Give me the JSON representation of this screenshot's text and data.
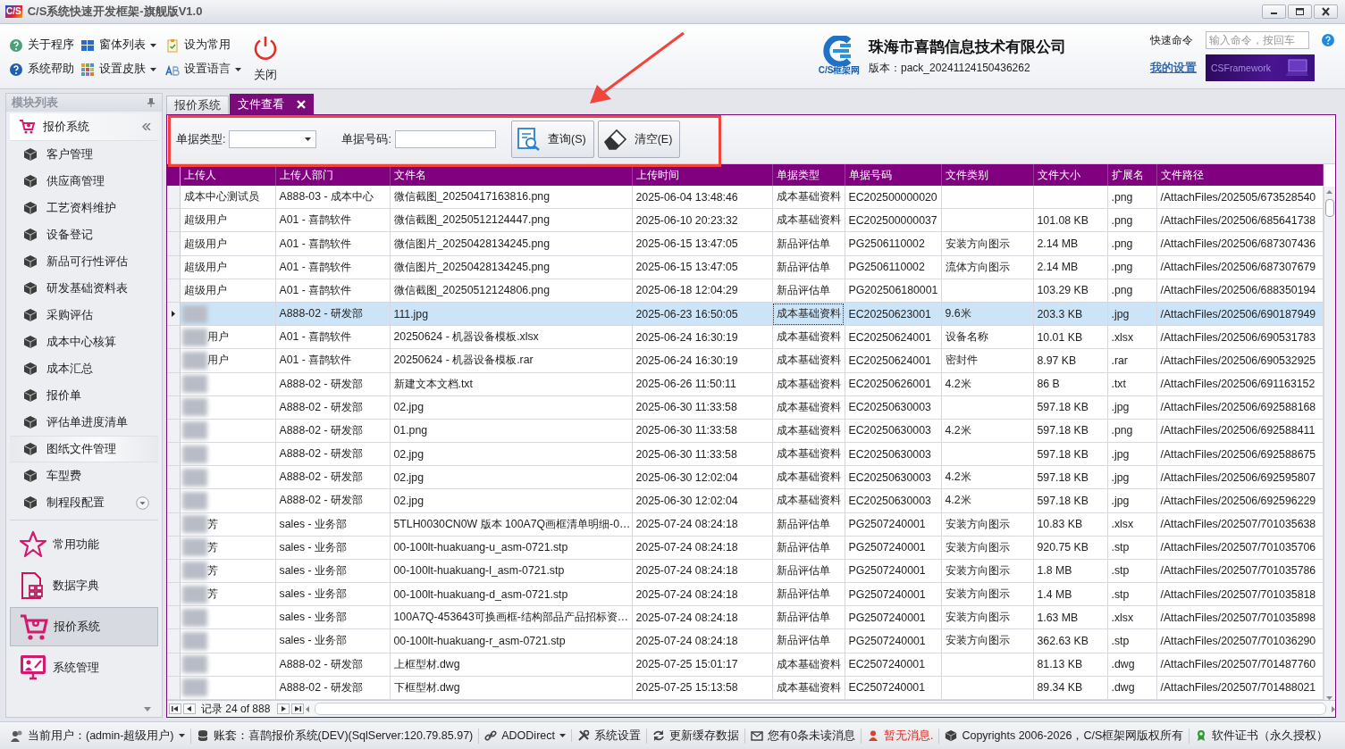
{
  "window": {
    "app_icon_text": "C/S",
    "title": "C/S系统快速开发框架-旗舰版V1.0"
  },
  "ribbon": {
    "buttons": [
      {
        "label": "关于程序",
        "has_menu": false
      },
      {
        "label": "窗体列表",
        "has_menu": true
      },
      {
        "label": "设为常用",
        "has_menu": false
      },
      {
        "label": "系统帮助",
        "has_menu": false
      },
      {
        "label": "设置皮肤",
        "has_menu": true
      },
      {
        "label": "设置语言",
        "has_menu": true
      }
    ],
    "close_button": {
      "label": "关闭"
    }
  },
  "company": {
    "logo_text": "C/S框架网",
    "name": "珠海市喜鹊信息技术有限公司",
    "version": "版本：pack_20241124150436262"
  },
  "quick_command": {
    "label": "快速命令",
    "placeholder": "输入命令，按回车"
  },
  "my_settings_link": "我的设置",
  "banner": {
    "text": "CSFramework"
  },
  "sidebar": {
    "title": "模块列表",
    "group": "报价系统",
    "items": [
      {
        "label": "客户管理",
        "selected": false
      },
      {
        "label": "供应商管理",
        "selected": false
      },
      {
        "label": "工艺资料维护",
        "selected": false
      },
      {
        "label": "设备登记",
        "selected": false
      },
      {
        "label": "新品可行性评估",
        "selected": false
      },
      {
        "label": "研发基础资料表",
        "selected": false
      },
      {
        "label": "采购评估",
        "selected": false
      },
      {
        "label": "成本中心核算",
        "selected": false
      },
      {
        "label": "成本汇总",
        "selected": false
      },
      {
        "label": "报价单",
        "selected": false
      },
      {
        "label": "评估单进度清单",
        "selected": false
      },
      {
        "label": "图纸文件管理",
        "selected": true
      },
      {
        "label": "车型费",
        "selected": false
      },
      {
        "label": "制程段配置",
        "selected": false
      }
    ],
    "nav": [
      {
        "label": "常用功能",
        "selected": false
      },
      {
        "label": "数据字典",
        "selected": false
      },
      {
        "label": "报价系统",
        "selected": true
      },
      {
        "label": "系统管理",
        "selected": false
      }
    ]
  },
  "tabs": [
    {
      "label": "报价系统",
      "selected": false,
      "closable": false
    },
    {
      "label": "文件查看",
      "selected": true,
      "closable": true
    }
  ],
  "filter": {
    "fields": [
      {
        "label": "单据类型:",
        "kind": "combo"
      },
      {
        "label": "单据号码:",
        "kind": "text"
      }
    ],
    "buttons": [
      {
        "label": "查询(S)"
      },
      {
        "label": "清空(E)"
      }
    ]
  },
  "table": {
    "columns": [
      "上传人",
      "上传人部门",
      "文件名",
      "上传时间",
      "单据类型",
      "单据号码",
      "文件类别",
      "文件大小",
      "扩展名",
      "文件路径"
    ],
    "rows": [
      {
        "selected": false,
        "blurred": false,
        "uploader": "成本中心测试员",
        "department": "A888-03 - 成本中心",
        "file_name": "微信截图_20250417163816.png",
        "upload_time": "2025-06-04 13:48:46",
        "doc_type": "成本基础资料",
        "doc_no": "EC202500000020",
        "extension": ".png",
        "file_path": "/AttachFiles/202505/673528540"
      },
      {
        "selected": false,
        "blurred": false,
        "uploader": "超级用户",
        "department": "A01 - 喜鹊软件",
        "file_name": "微信截图_20250512124447.png",
        "upload_time": "2025-06-10 20:23:32",
        "doc_type": "成本基础资料",
        "doc_no": "EC202500000037",
        "file_size": "101.08 KB",
        "extension": ".png",
        "file_path": "/AttachFiles/202506/685641738"
      },
      {
        "selected": false,
        "blurred": false,
        "uploader": "超级用户",
        "department": "A01 - 喜鹊软件",
        "file_name": "微信图片_20250428134245.png",
        "upload_time": "2025-06-15 13:47:05",
        "doc_type": "新品评估单",
        "doc_no": "PG2506110002",
        "file_category": "安装方向图示",
        "file_size": "2.14 MB",
        "extension": ".png",
        "file_path": "/AttachFiles/202506/687307436"
      },
      {
        "selected": false,
        "blurred": false,
        "uploader": "超级用户",
        "department": "A01 - 喜鹊软件",
        "file_name": "微信图片_20250428134245.png",
        "upload_time": "2025-06-15 13:47:05",
        "doc_type": "新品评估单",
        "doc_no": "PG2506110002",
        "file_category": "流体方向图示",
        "file_size": "2.14 MB",
        "extension": ".png",
        "file_path": "/AttachFiles/202506/687307679"
      },
      {
        "selected": false,
        "blurred": false,
        "uploader": "超级用户",
        "department": "A01 - 喜鹊软件",
        "file_name": "微信截图_20250512124806.png",
        "upload_time": "2025-06-18 12:04:29",
        "doc_type": "新品评估单",
        "doc_no": "PG202506180001",
        "file_size": "103.29 KB",
        "extension": ".png",
        "file_path": "/AttachFiles/202506/688350194"
      },
      {
        "selected": true,
        "blurred": true,
        "department": "A888-02 - 研发部",
        "file_name": "111.jpg",
        "upload_time": "2025-06-23 16:50:05",
        "doc_type": "成本基础资料",
        "doc_no": "EC20250623001",
        "file_category": "9.6米",
        "file_size": "203.3 KB",
        "extension": ".jpg",
        "file_path": "/AttachFiles/202506/690187949"
      },
      {
        "selected": false,
        "blurred": true,
        "uploader": "用户",
        "department": "A01 - 喜鹊软件",
        "file_name": "20250624 - 机器设备模板.xlsx",
        "upload_time": "2025-06-24 16:30:19",
        "doc_type": "成本基础资料",
        "doc_no": "EC20250624001",
        "file_category": "设备名称",
        "file_size": "10.01 KB",
        "extension": ".xlsx",
        "file_path": "/AttachFiles/202506/690531783"
      },
      {
        "selected": false,
        "blurred": true,
        "uploader": "用户",
        "department": "A01 - 喜鹊软件",
        "file_name": "20250624 - 机器设备模板.rar",
        "upload_time": "2025-06-24 16:30:19",
        "doc_type": "成本基础资料",
        "doc_no": "EC20250624001",
        "file_category": "密封件",
        "file_size": "8.97 KB",
        "extension": ".rar",
        "file_path": "/AttachFiles/202506/690532925"
      },
      {
        "selected": false,
        "blurred": true,
        "department": "A888-02 - 研发部",
        "file_name": "新建文本文档.txt",
        "upload_time": "2025-06-26 11:50:11",
        "doc_type": "成本基础资料",
        "doc_no": "EC20250626001",
        "file_category": "4.2米",
        "file_size": "86 B",
        "extension": ".txt",
        "file_path": "/AttachFiles/202506/691163152"
      },
      {
        "selected": false,
        "blurred": true,
        "department": "A888-02 - 研发部",
        "file_name": "02.jpg",
        "upload_time": "2025-06-30 11:33:58",
        "doc_type": "成本基础资料",
        "doc_no": "EC20250630003",
        "file_size": "597.18 KB",
        "extension": ".jpg",
        "file_path": "/AttachFiles/202506/692588168"
      },
      {
        "selected": false,
        "blurred": true,
        "department": "A888-02 - 研发部",
        "file_name": "01.png",
        "upload_time": "2025-06-30 11:33:58",
        "doc_type": "成本基础资料",
        "doc_no": "EC20250630003",
        "file_category": "4.2米",
        "file_size": "597.18 KB",
        "extension": ".png",
        "file_path": "/AttachFiles/202506/692588411"
      },
      {
        "selected": false,
        "blurred": true,
        "department": "A888-02 - 研发部",
        "file_name": "02.jpg",
        "upload_time": "2025-06-30 11:33:58",
        "doc_type": "成本基础资料",
        "doc_no": "EC20250630003",
        "file_size": "597.18 KB",
        "extension": ".jpg",
        "file_path": "/AttachFiles/202506/692588675"
      },
      {
        "selected": false,
        "blurred": true,
        "department": "A888-02 - 研发部",
        "file_name": "02.jpg",
        "upload_time": "2025-06-30 12:02:04",
        "doc_type": "成本基础资料",
        "doc_no": "EC20250630003",
        "file_category": "4.2米",
        "file_size": "597.18 KB",
        "extension": ".jpg",
        "file_path": "/AttachFiles/202506/692595807"
      },
      {
        "selected": false,
        "blurred": true,
        "department": "A888-02 - 研发部",
        "file_name": "02.jpg",
        "upload_time": "2025-06-30 12:02:04",
        "doc_type": "成本基础资料",
        "doc_no": "EC20250630003",
        "file_category": "4.2米",
        "file_size": "597.18 KB",
        "extension": ".jpg",
        "file_path": "/AttachFiles/202506/692596229"
      },
      {
        "selected": false,
        "blurred": true,
        "uploader": "芳",
        "department": "sales - 业务部",
        "file_name": "5TLH0030CN0W 版本 100A7Q画框清单明细-0…",
        "upload_time": "2025-07-24 08:24:18",
        "doc_type": "新品评估单",
        "doc_no": "PG2507240001",
        "file_category": "安装方向图示",
        "file_size": "10.83 KB",
        "extension": ".xlsx",
        "file_path": "/AttachFiles/202507/701035638"
      },
      {
        "selected": false,
        "blurred": true,
        "uploader": "芳",
        "department": "sales - 业务部",
        "file_name": "00-100lt-huakuang-u_asm-0721.stp",
        "upload_time": "2025-07-24 08:24:18",
        "doc_type": "新品评估单",
        "doc_no": "PG2507240001",
        "file_category": "安装方向图示",
        "file_size": "920.75 KB",
        "extension": ".stp",
        "file_path": "/AttachFiles/202507/701035706"
      },
      {
        "selected": false,
        "blurred": true,
        "uploader": "芳",
        "department": "sales - 业务部",
        "file_name": "00-100lt-huakuang-l_asm-0721.stp",
        "upload_time": "2025-07-24 08:24:18",
        "doc_type": "新品评估单",
        "doc_no": "PG2507240001",
        "file_category": "安装方向图示",
        "file_size": "1.8 MB",
        "extension": ".stp",
        "file_path": "/AttachFiles/202507/701035786"
      },
      {
        "selected": false,
        "blurred": true,
        "uploader": "芳",
        "department": "sales - 业务部",
        "file_name": "00-100lt-huakuang-d_asm-0721.stp",
        "upload_time": "2025-07-24 08:24:18",
        "doc_type": "新品评估单",
        "doc_no": "PG2507240001",
        "file_category": "安装方向图示",
        "file_size": "1.4 MB",
        "extension": ".stp",
        "file_path": "/AttachFiles/202507/701035818"
      },
      {
        "selected": false,
        "blurred": true,
        "department": "sales - 业务部",
        "file_name": "100A7Q-453643可换画框-结构部品产品招标资…",
        "upload_time": "2025-07-24 08:24:18",
        "doc_type": "新品评估单",
        "doc_no": "PG2507240001",
        "file_category": "安装方向图示",
        "file_size": "1.63 MB",
        "extension": ".xlsx",
        "file_path": "/AttachFiles/202507/701035898"
      },
      {
        "selected": false,
        "blurred": true,
        "department": "sales - 业务部",
        "file_name": "00-100lt-huakuang-r_asm-0721.stp",
        "upload_time": "2025-07-24 08:24:18",
        "doc_type": "新品评估单",
        "doc_no": "PG2507240001",
        "file_category": "安装方向图示",
        "file_size": "362.63 KB",
        "extension": ".stp",
        "file_path": "/AttachFiles/202507/701036290"
      },
      {
        "selected": false,
        "blurred": true,
        "department": "A888-02 - 研发部",
        "file_name": "上框型材.dwg",
        "upload_time": "2025-07-25 15:01:17",
        "doc_type": "成本基础资料",
        "doc_no": "EC2507240001",
        "file_size": "81.13 KB",
        "extension": ".dwg",
        "file_path": "/AttachFiles/202507/701487760"
      },
      {
        "selected": false,
        "blurred": true,
        "department": "A888-02 - 研发部",
        "file_name": "下框型材.dwg",
        "upload_time": "2025-07-25 15:13:58",
        "doc_type": "成本基础资料",
        "doc_no": "EC2507240001",
        "file_size": "89.34 KB",
        "extension": ".dwg",
        "file_path": "/AttachFiles/202507/701488021"
      }
    ]
  },
  "navigator": {
    "record_text": "记录 24 of 888"
  },
  "status_bar": [
    {
      "text": "当前用户：(admin-超级用户)",
      "has_menu": true,
      "alert": false
    },
    {
      "text": "账套：喜鹊报价系统(DEV)(SqlServer:120.79.85.97)",
      "has_menu": false,
      "alert": false
    },
    {
      "text": "ADODirect",
      "has_menu": true,
      "alert": false
    },
    {
      "text": "系统设置",
      "has_menu": false,
      "alert": false
    },
    {
      "text": "更新缓存数据",
      "has_menu": false,
      "alert": false
    },
    {
      "text": "您有0条未读消息",
      "has_menu": false,
      "alert": false
    },
    {
      "text": "暂无消息.",
      "has_menu": false,
      "alert": true
    },
    {
      "text": "Copyrights 2006-2026，C/S框架网版权所有",
      "has_menu": false,
      "alert": false
    },
    {
      "text": "软件证书（永久授权）",
      "has_menu": false,
      "alert": false
    }
  ],
  "annotations": {
    "arrow": true,
    "highlight_box": true
  }
}
